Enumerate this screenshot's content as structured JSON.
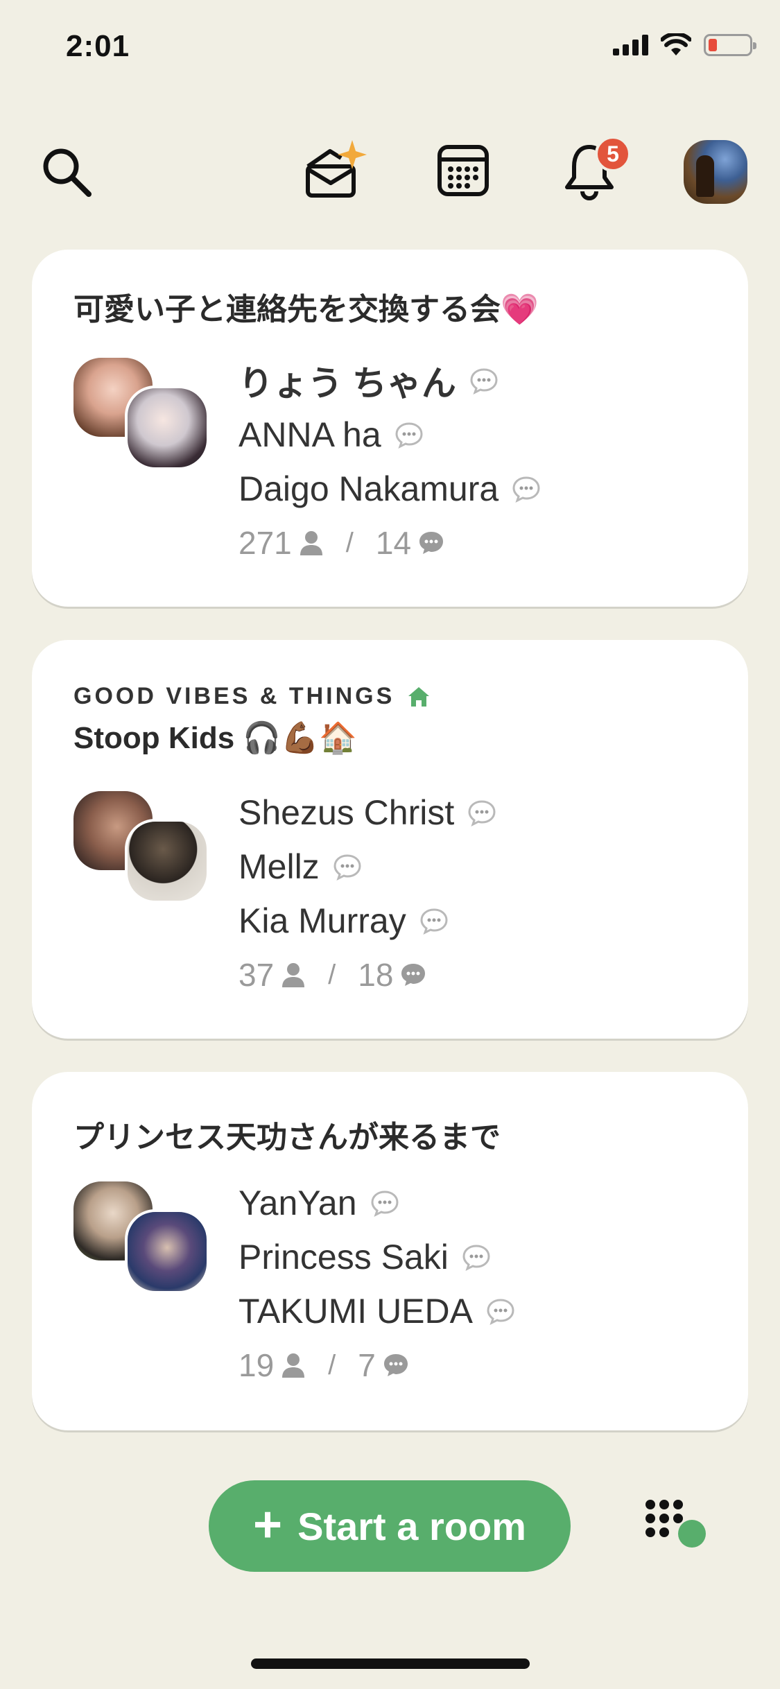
{
  "status_bar": {
    "time": "2:01"
  },
  "nav": {
    "notification_count": "5"
  },
  "rooms": [
    {
      "club": "",
      "title": "可愛い子と連絡先を交換する会💗",
      "speakers": [
        "りょう ちゃん",
        "ANNA ha",
        "Daigo Nakamura"
      ],
      "listeners": "271",
      "chats": "14"
    },
    {
      "club": "GOOD VIBES & THINGS",
      "title": "Stoop Kids 🎧💪🏾🏠",
      "speakers": [
        "Shezus Christ",
        "Mellz",
        "Kia Murray"
      ],
      "listeners": "37",
      "chats": "18"
    },
    {
      "club": "",
      "title": "プリンセス天功さんが来るまで",
      "speakers": [
        "YanYan",
        "Princess Saki",
        "TAKUMI UEDA"
      ],
      "listeners": "19",
      "chats": "7"
    }
  ],
  "stats_separator": "/",
  "start_room": {
    "plus": "+",
    "label": "Start a room"
  },
  "colors": {
    "background": "#f1efe4",
    "accent_green": "#58ae6c",
    "badge_red": "#e2553c"
  }
}
